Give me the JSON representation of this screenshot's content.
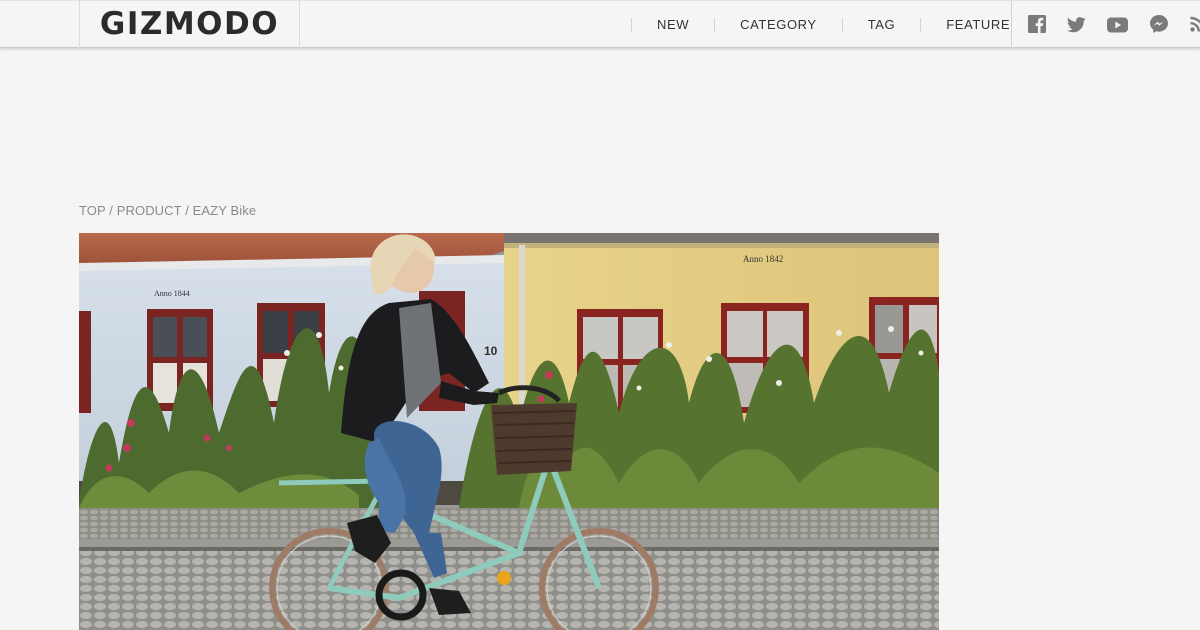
{
  "brand": {
    "logo_text": "GIZMODO"
  },
  "nav": {
    "items": [
      {
        "label": "NEW"
      },
      {
        "label": "CATEGORY"
      },
      {
        "label": "TAG"
      },
      {
        "label": "FEATURE"
      }
    ]
  },
  "social": {
    "icons": [
      "facebook-icon",
      "twitter-icon",
      "youtube-icon",
      "messenger-icon",
      "rss-icon"
    ]
  },
  "breadcrumb": {
    "items": [
      "TOP",
      "PRODUCT",
      "EAZY Bike"
    ],
    "separator": "/"
  },
  "house_signs": {
    "left": "Anno 1844",
    "right": "Anno 1842",
    "door_number": "10"
  },
  "colors": {
    "background": "#f5f5f5",
    "logo": "#2b2b2b",
    "nav_text": "#333333",
    "breadcrumb_text": "#8a8a8a",
    "social_icon": "#7a7a7a"
  }
}
